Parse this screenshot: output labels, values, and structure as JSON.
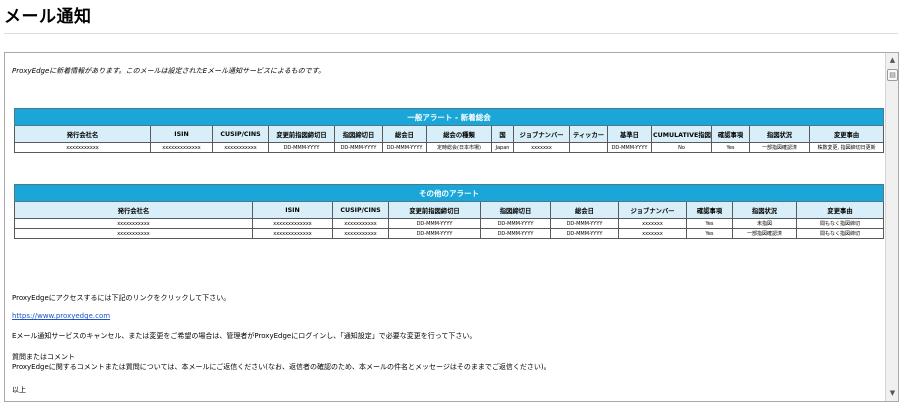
{
  "page": {
    "title": "メール通知"
  },
  "email": {
    "intro": "ProxyEdgeに新着情報があります。このメールは設定されたEメール通知サービスによるものです。",
    "table1": {
      "caption": "一般アラート - 新着総会",
      "headers": [
        "発行会社名",
        "ISIN",
        "CUSIP/CINS",
        "変更前指図締切日",
        "指図締切日",
        "総会日",
        "総会の種類",
        "国",
        "ジョブナンバー",
        "ティッカー",
        "基準日",
        "CUMULATIVE指図",
        "確認事項",
        "指図状況",
        "変更事由"
      ],
      "rows": [
        [
          "xxxxxxxxxxx",
          "xxxxxxxxxxxxx",
          "xxxxxxxxxxx",
          "DD-MMM-YYYY",
          "DD-MMM-YYYY",
          "DD-MMM-YYYY",
          "定時総会(日本市場)",
          "Japan",
          "xxxxxxx",
          "",
          "DD-MMM-YYYY",
          "No",
          "Yes",
          "一部指図確認済",
          "株数変更, 指図締切日更新"
        ]
      ]
    },
    "table2": {
      "caption": "その他のアラート",
      "headers": [
        "発行会社名",
        "ISIN",
        "CUSIP/CINS",
        "変更前指図締切日",
        "指図締切日",
        "総会日",
        "ジョブナンバー",
        "確認事項",
        "指図状況",
        "変更事由"
      ],
      "rows": [
        [
          "xxxxxxxxxxx",
          "xxxxxxxxxxxxx",
          "xxxxxxxxxxx",
          "DD-MMM-YYYY",
          "DD-MMM-YYYY",
          "DD-MMM-YYYY",
          "xxxxxxx",
          "Yes",
          "未指図",
          "間もなく指図締切"
        ],
        [
          "xxxxxxxxxxx",
          "xxxxxxxxxxxxx",
          "xxxxxxxxxxx",
          "DD-MMM-YYYY",
          "DD-MMM-YYYY",
          "DD-MMM-YYYY",
          "xxxxxxx",
          "Yes",
          "一部指図確認済",
          "間もなく指図締切"
        ]
      ]
    },
    "access_text": "ProxyEdgeにアクセスするには下記のリンクをクリックして下さい。",
    "link": "https://www.proxyedge.com",
    "cancel_text": "Eメール通知サービスのキャンセル、または変更をご希望の場合は、管理者がProxyEdgeにログインし、「通知設定」で必要な変更を行って下さい。",
    "questions_heading": "質問またはコメント",
    "questions_text": "ProxyEdgeに関するコメントまたは質問については、本メールにご返信ください(なお、返信者の確認のため、本メールの件名とメッセージはそのままでご返信ください)。",
    "closing": "以上"
  },
  "icons": {
    "scroll_up": "scroll-up-arrow-icon",
    "scroll_down": "scroll-down-arrow-icon",
    "frame_icon": "document-icon"
  }
}
